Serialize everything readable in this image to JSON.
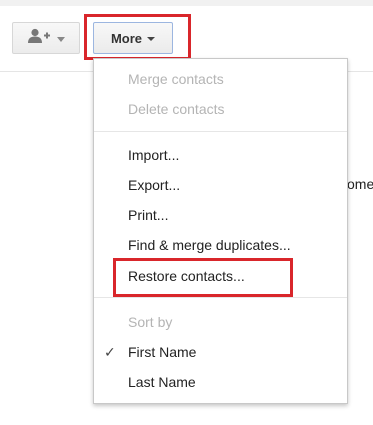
{
  "toolbar": {
    "add_contact_icon": "person-add-icon",
    "more_label": "More"
  },
  "menu": {
    "merge_contacts": "Merge contacts",
    "delete_contacts": "Delete contacts",
    "import": "Import...",
    "export": "Export...",
    "print": "Print...",
    "find_merge_duplicates": "Find & merge duplicates...",
    "restore_contacts": "Restore contacts...",
    "sort_by": "Sort by",
    "first_name": "First Name",
    "last_name": "Last Name",
    "checkmark": "✓"
  },
  "background": {
    "partial_text": "ome"
  },
  "colors": {
    "highlight": "#d9262b",
    "disabled_text": "#b4b4b4",
    "more_border": "#9cb6e0"
  }
}
